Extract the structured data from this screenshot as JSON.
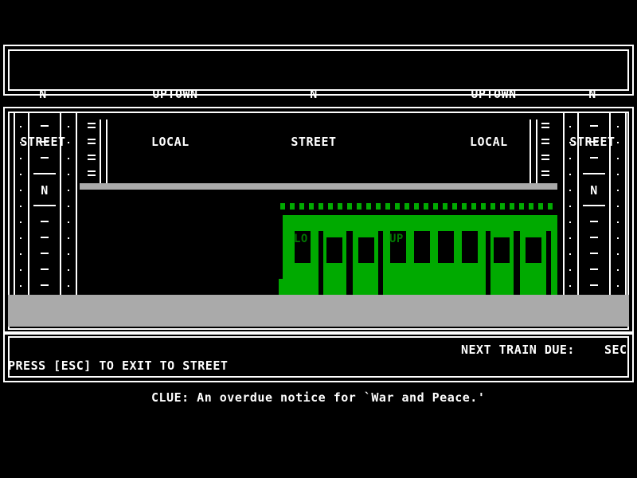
{
  "header_signs": [
    {
      "line1": "N",
      "line2": "STREET"
    },
    {
      "line1": "UPTOWN",
      "line2": "LOCAL"
    },
    {
      "line1": "N",
      "line2": "STREET"
    },
    {
      "line1": "UPTOWN",
      "line2": "LOCAL"
    },
    {
      "line1": "N",
      "line2": "STREET"
    }
  ],
  "pillar_letter": "N",
  "train": {
    "color": "#00aa00",
    "label_left": "LO",
    "label_right": "UP"
  },
  "status": {
    "next_train_label": "NEXT TRAIN DUE:",
    "next_train_unit": "SEC",
    "exit_hint": "PRESS [ESC] TO EXIT TO STREET"
  },
  "clue": "CLUE: An overdue notice for `War and Peace.'"
}
